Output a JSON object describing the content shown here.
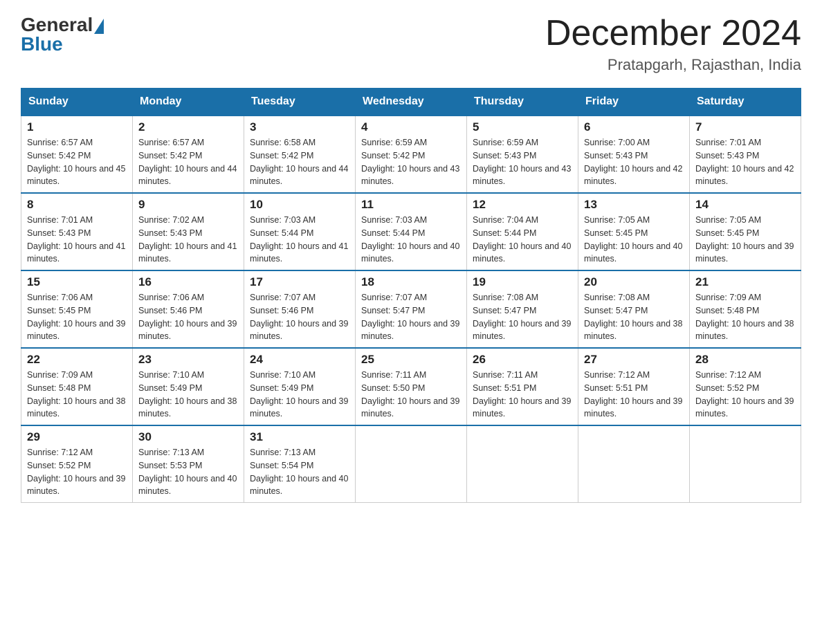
{
  "header": {
    "logo_general": "General",
    "logo_blue": "Blue",
    "month_title": "December 2024",
    "location": "Pratapgarh, Rajasthan, India"
  },
  "days_of_week": [
    "Sunday",
    "Monday",
    "Tuesday",
    "Wednesday",
    "Thursday",
    "Friday",
    "Saturday"
  ],
  "weeks": [
    [
      {
        "date": "1",
        "sunrise": "6:57 AM",
        "sunset": "5:42 PM",
        "daylight": "10 hours and 45 minutes."
      },
      {
        "date": "2",
        "sunrise": "6:57 AM",
        "sunset": "5:42 PM",
        "daylight": "10 hours and 44 minutes."
      },
      {
        "date": "3",
        "sunrise": "6:58 AM",
        "sunset": "5:42 PM",
        "daylight": "10 hours and 44 minutes."
      },
      {
        "date": "4",
        "sunrise": "6:59 AM",
        "sunset": "5:42 PM",
        "daylight": "10 hours and 43 minutes."
      },
      {
        "date": "5",
        "sunrise": "6:59 AM",
        "sunset": "5:43 PM",
        "daylight": "10 hours and 43 minutes."
      },
      {
        "date": "6",
        "sunrise": "7:00 AM",
        "sunset": "5:43 PM",
        "daylight": "10 hours and 42 minutes."
      },
      {
        "date": "7",
        "sunrise": "7:01 AM",
        "sunset": "5:43 PM",
        "daylight": "10 hours and 42 minutes."
      }
    ],
    [
      {
        "date": "8",
        "sunrise": "7:01 AM",
        "sunset": "5:43 PM",
        "daylight": "10 hours and 41 minutes."
      },
      {
        "date": "9",
        "sunrise": "7:02 AM",
        "sunset": "5:43 PM",
        "daylight": "10 hours and 41 minutes."
      },
      {
        "date": "10",
        "sunrise": "7:03 AM",
        "sunset": "5:44 PM",
        "daylight": "10 hours and 41 minutes."
      },
      {
        "date": "11",
        "sunrise": "7:03 AM",
        "sunset": "5:44 PM",
        "daylight": "10 hours and 40 minutes."
      },
      {
        "date": "12",
        "sunrise": "7:04 AM",
        "sunset": "5:44 PM",
        "daylight": "10 hours and 40 minutes."
      },
      {
        "date": "13",
        "sunrise": "7:05 AM",
        "sunset": "5:45 PM",
        "daylight": "10 hours and 40 minutes."
      },
      {
        "date": "14",
        "sunrise": "7:05 AM",
        "sunset": "5:45 PM",
        "daylight": "10 hours and 39 minutes."
      }
    ],
    [
      {
        "date": "15",
        "sunrise": "7:06 AM",
        "sunset": "5:45 PM",
        "daylight": "10 hours and 39 minutes."
      },
      {
        "date": "16",
        "sunrise": "7:06 AM",
        "sunset": "5:46 PM",
        "daylight": "10 hours and 39 minutes."
      },
      {
        "date": "17",
        "sunrise": "7:07 AM",
        "sunset": "5:46 PM",
        "daylight": "10 hours and 39 minutes."
      },
      {
        "date": "18",
        "sunrise": "7:07 AM",
        "sunset": "5:47 PM",
        "daylight": "10 hours and 39 minutes."
      },
      {
        "date": "19",
        "sunrise": "7:08 AM",
        "sunset": "5:47 PM",
        "daylight": "10 hours and 39 minutes."
      },
      {
        "date": "20",
        "sunrise": "7:08 AM",
        "sunset": "5:47 PM",
        "daylight": "10 hours and 38 minutes."
      },
      {
        "date": "21",
        "sunrise": "7:09 AM",
        "sunset": "5:48 PM",
        "daylight": "10 hours and 38 minutes."
      }
    ],
    [
      {
        "date": "22",
        "sunrise": "7:09 AM",
        "sunset": "5:48 PM",
        "daylight": "10 hours and 38 minutes."
      },
      {
        "date": "23",
        "sunrise": "7:10 AM",
        "sunset": "5:49 PM",
        "daylight": "10 hours and 38 minutes."
      },
      {
        "date": "24",
        "sunrise": "7:10 AM",
        "sunset": "5:49 PM",
        "daylight": "10 hours and 39 minutes."
      },
      {
        "date": "25",
        "sunrise": "7:11 AM",
        "sunset": "5:50 PM",
        "daylight": "10 hours and 39 minutes."
      },
      {
        "date": "26",
        "sunrise": "7:11 AM",
        "sunset": "5:51 PM",
        "daylight": "10 hours and 39 minutes."
      },
      {
        "date": "27",
        "sunrise": "7:12 AM",
        "sunset": "5:51 PM",
        "daylight": "10 hours and 39 minutes."
      },
      {
        "date": "28",
        "sunrise": "7:12 AM",
        "sunset": "5:52 PM",
        "daylight": "10 hours and 39 minutes."
      }
    ],
    [
      {
        "date": "29",
        "sunrise": "7:12 AM",
        "sunset": "5:52 PM",
        "daylight": "10 hours and 39 minutes."
      },
      {
        "date": "30",
        "sunrise": "7:13 AM",
        "sunset": "5:53 PM",
        "daylight": "10 hours and 40 minutes."
      },
      {
        "date": "31",
        "sunrise": "7:13 AM",
        "sunset": "5:54 PM",
        "daylight": "10 hours and 40 minutes."
      },
      null,
      null,
      null,
      null
    ]
  ],
  "labels": {
    "sunrise": "Sunrise:",
    "sunset": "Sunset:",
    "daylight": "Daylight:"
  }
}
